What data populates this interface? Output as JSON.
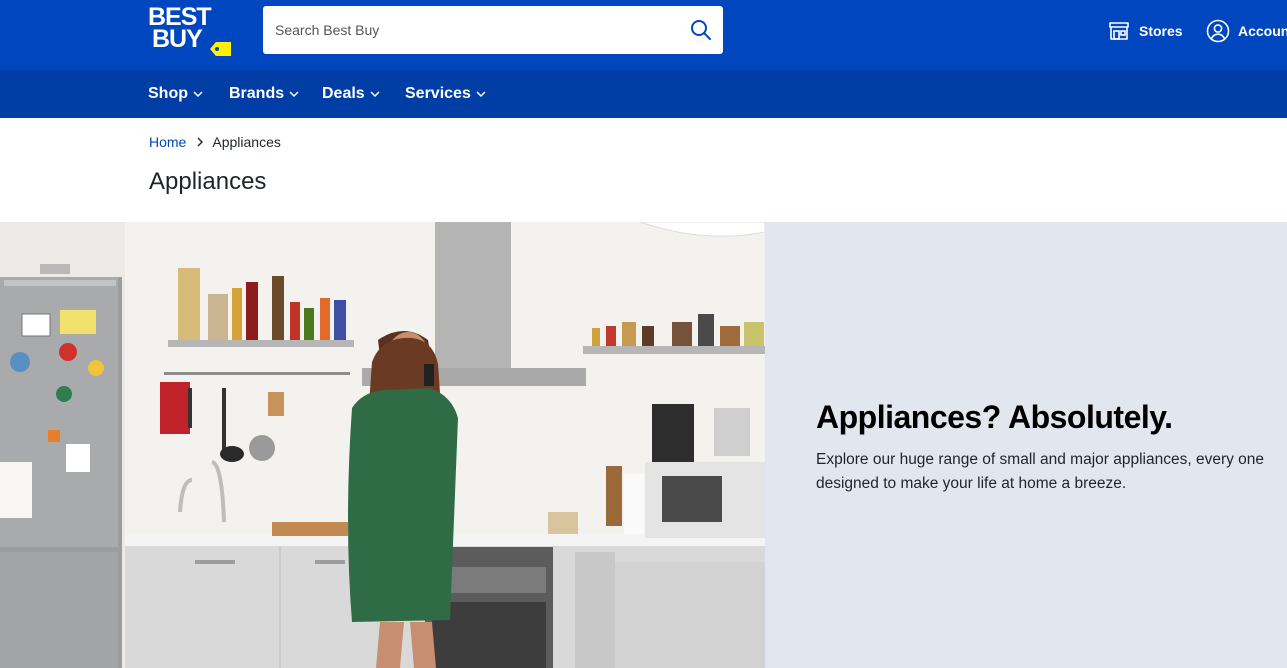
{
  "header": {
    "logo_text_line1": "BEST",
    "logo_text_line2": "BUY",
    "search_placeholder": "Search Best Buy",
    "stores_label": "Stores",
    "account_label": "Account",
    "brand_color": "#0046be",
    "tag_color": "#fff200"
  },
  "nav": {
    "items": [
      {
        "label": "Shop"
      },
      {
        "label": "Brands"
      },
      {
        "label": "Deals"
      },
      {
        "label": "Services"
      }
    ],
    "color": "#003da5"
  },
  "breadcrumb": {
    "home": "Home",
    "current": "Appliances"
  },
  "page": {
    "title": "Appliances"
  },
  "hero": {
    "headline": "Appliances? Absolutely.",
    "body": "Explore our huge range of small and major appliances, every one designed to make your life at home a breeze.",
    "panel_color": "#e2e6ef"
  },
  "icons": [
    "search-icon",
    "store-icon",
    "account-icon",
    "chevron-down-icon",
    "chevron-right-icon"
  ]
}
